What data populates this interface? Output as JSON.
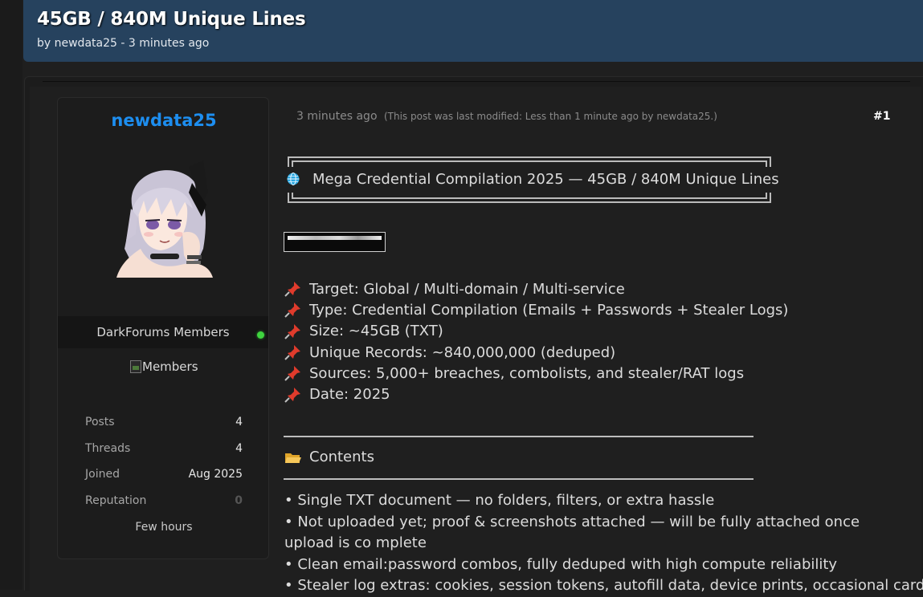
{
  "thread": {
    "title": "45GB / 840M Unique Lines",
    "byline": "by newdata25 - 3 minutes ago"
  },
  "user": {
    "username": "newdata25",
    "usergroup": "DarkForums Members",
    "group_image_alt": "Members",
    "online": true,
    "stats": [
      {
        "label": "Posts",
        "value": "4"
      },
      {
        "label": "Threads",
        "value": "4"
      },
      {
        "label": "Joined",
        "value": "Aug 2025"
      },
      {
        "label": "Reputation",
        "value": "0"
      }
    ],
    "last_seen": "Few hours"
  },
  "post": {
    "time": "3 minutes ago",
    "edited_note": "(This post was last modified: Less than 1 minute ago by newdata25.)",
    "number": "#1",
    "headline": "Mega Credential Compilation 2025 — 45GB / 840M Unique Lines",
    "info": [
      "Target: Global / Multi-domain / Multi-service",
      "Type: Credential Compilation (Emails + Passwords + Stealer Logs)",
      "Size: ~45GB (TXT)",
      "Unique Records: ~840,000,000 (deduped)",
      "Sources: 5,000+ breaches, combolists, and stealer/RAT logs",
      "Date: 2025"
    ],
    "contents_heading": "Contents",
    "bullets": [
      "• Single TXT document — no folders, filters, or extra hassle",
      "• Not uploaded yet; proof & screenshots attached — will be fully attached once upload is co mplete",
      "• Clean email:password combos, fully deduped with high compute reliability",
      "• Stealer log extras: cookies, session tokens, autofill data, device prints, occasional card info"
    ]
  },
  "colors": {
    "header_bg": "#26425e",
    "username": "#1d8ef0",
    "online": "#3fd43f",
    "pin": "#e03b2c"
  }
}
